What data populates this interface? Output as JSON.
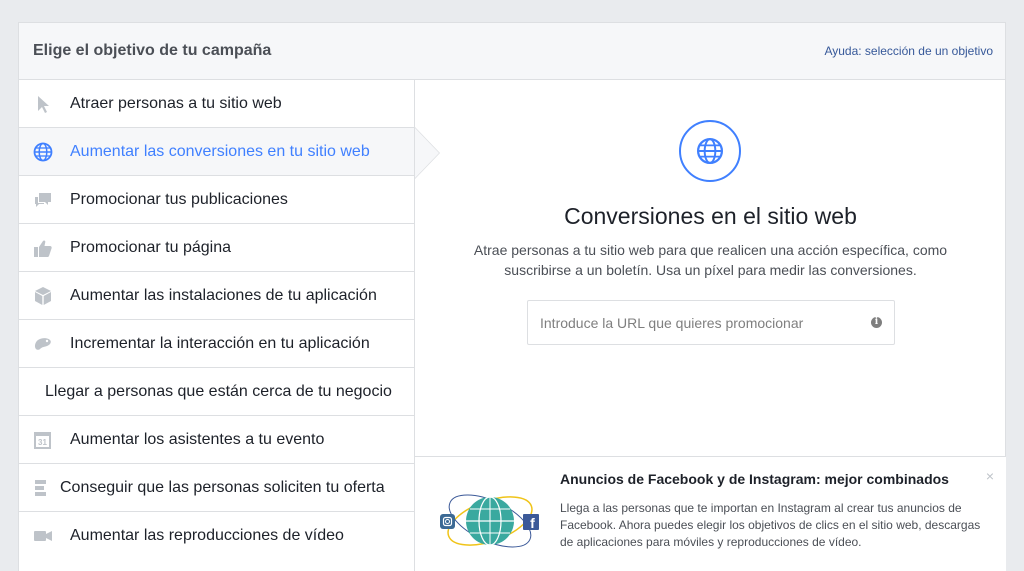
{
  "header": {
    "title": "Elige el objetivo de tu campaña",
    "help_link": "Ayuda: selección de un objetivo"
  },
  "objectives": [
    {
      "label": "Atraer personas a tu sitio web",
      "icon": "cursor-icon"
    },
    {
      "label": "Aumentar las conversiones en tu sitio web",
      "icon": "globe-icon",
      "selected": true
    },
    {
      "label": "Promocionar tus publicaciones",
      "icon": "speech-bubbles-icon"
    },
    {
      "label": "Promocionar tu página",
      "icon": "thumbs-up-icon"
    },
    {
      "label": "Aumentar las instalaciones de tu aplicación",
      "icon": "box-icon"
    },
    {
      "label": "Incrementar la interacción en tu aplicación",
      "icon": "gamepad-icon"
    },
    {
      "label": "Llegar a personas que están cerca de tu negocio",
      "icon": null
    },
    {
      "label": "Aumentar los asistentes a tu evento",
      "icon": "calendar-icon"
    },
    {
      "label": "Conseguir que las personas soliciten tu oferta",
      "icon": "offer-tag-icon"
    },
    {
      "label": "Aumentar las reproducciones de vídeo",
      "icon": "video-camera-icon"
    }
  ],
  "detail": {
    "title": "Conversiones en el sitio web",
    "description": "Atrae personas a tu sitio web para que realicen una acción específica, como suscribirse a un boletín. Usa un píxel para medir las conversiones.",
    "url_placeholder": "Introduce la URL que quieres promocionar",
    "url_value": ""
  },
  "promo": {
    "title": "Anuncios de Facebook y de Instagram: mejor combinados",
    "text": "Llega a las personas que te importan en Instagram al crear tus anuncios de Facebook. Ahora puedes elegir los objetivos de clics en el sitio web, descargas de aplicaciones para móviles y reproducciones de vídeo.",
    "close": "×"
  },
  "colors": {
    "accent": "#4080ff",
    "icon_gray": "#bec3c9",
    "link": "#365899",
    "facebook_blue": "#3b5998",
    "globe_teal": "#3aa99f"
  }
}
